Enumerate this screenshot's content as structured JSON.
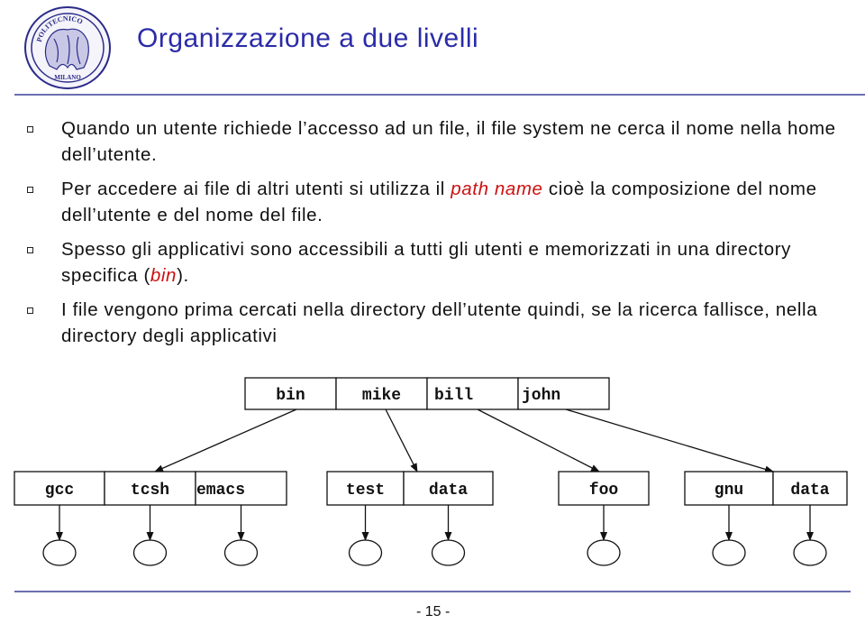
{
  "header": {
    "title": "Organizzazione a due livelli",
    "logo": {
      "icon": "politecnico-milano-seal-icon",
      "top_text": "POLITECNICO",
      "bottom_text": "MILANO",
      "color": "#2b2b8a"
    }
  },
  "bullets": [
    {
      "parts": [
        {
          "text": "Quando un utente richiede l’accesso ad un file, il file system ne cerca il nome nella home dell’utente.",
          "emphasis": false
        }
      ]
    },
    {
      "parts": [
        {
          "text": "Per accedere ai file di altri utenti si utilizza il ",
          "emphasis": false
        },
        {
          "text": "path name",
          "emphasis": true
        },
        {
          "text": " cioè la composizione del nome dell’utente e del nome del file.",
          "emphasis": false
        }
      ]
    },
    {
      "parts": [
        {
          "text": "Spesso gli applicativi sono accessibili a tutti gli utenti e memorizzati in una directory specifica (",
          "emphasis": false
        },
        {
          "text": "bin",
          "emphasis": true
        },
        {
          "text": ").",
          "emphasis": false
        }
      ]
    },
    {
      "parts": [
        {
          "text": "I file vengono prima cercati nella directory dell’utente quindi, se la ricerca fallisce, nella directory degli applicativi",
          "emphasis": false
        }
      ]
    }
  ],
  "diagram": {
    "root_directory": [
      "bin",
      "mike",
      "bill",
      "john"
    ],
    "user_directories": [
      {
        "parent": "bin",
        "entries": [
          "gcc",
          "tcsh",
          "emacs"
        ]
      },
      {
        "parent": "mike",
        "entries": [
          "test",
          "data"
        ]
      },
      {
        "parent": "bill",
        "entries": [
          "foo"
        ]
      },
      {
        "parent": "john",
        "entries": [
          "gnu",
          "data"
        ]
      }
    ],
    "file_nodes_count": 8
  },
  "footer": {
    "page_number": "- 15 -"
  },
  "colors": {
    "title": "#2b2ba8",
    "emphasis": "#cc1111",
    "rule": "#6b6fb0"
  }
}
